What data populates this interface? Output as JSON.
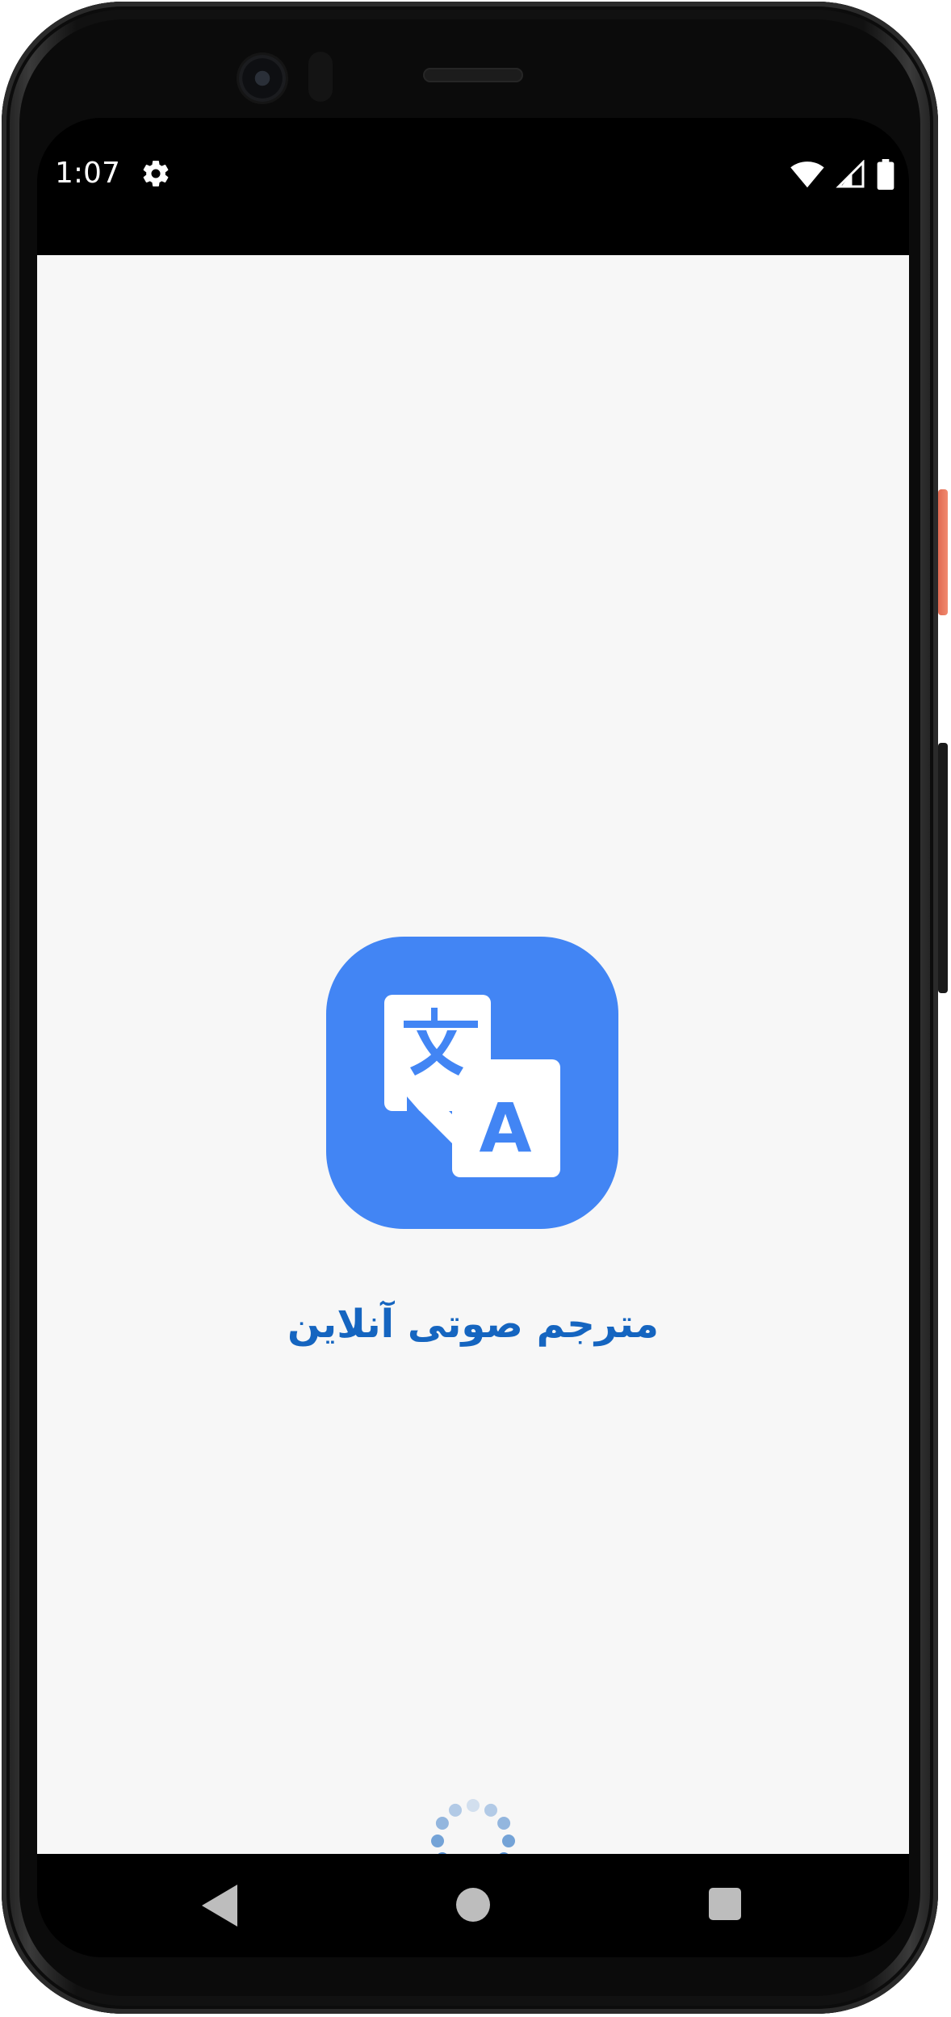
{
  "status_bar": {
    "time": "1:07",
    "icons": [
      "settings-gear-icon",
      "wifi-icon",
      "cell-signal-icon",
      "battery-icon"
    ]
  },
  "splash": {
    "app_icon": "translate-icon",
    "title": "مترجم صوتی آنلاین",
    "loading_indicator": "loading-spinner"
  },
  "nav_bar": {
    "buttons": [
      "back-icon",
      "home-icon",
      "recent-apps-icon"
    ]
  },
  "colors": {
    "icon_background": "#4285f4",
    "title": "#1565c0",
    "screen_background": "#f7f7f7",
    "spinner": "#1565c0"
  }
}
